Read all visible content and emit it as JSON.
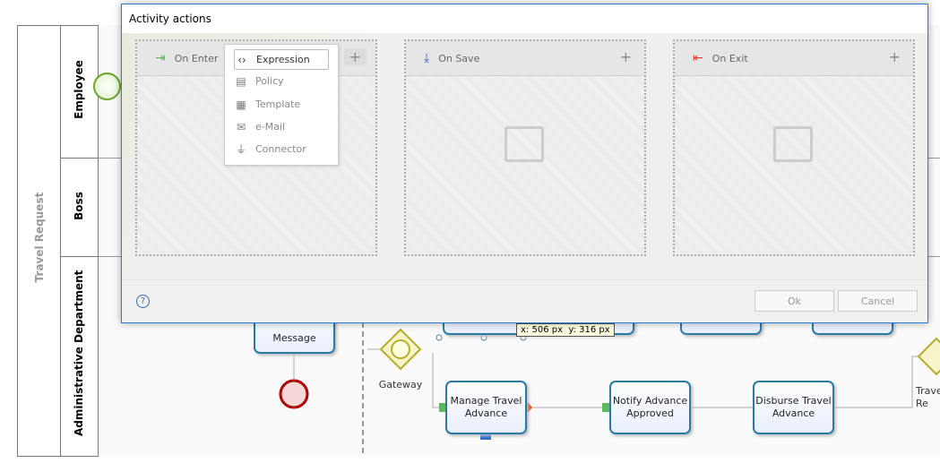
{
  "pool": {
    "label": "Travel Request",
    "lanes": [
      "Employee",
      "Boss",
      "Administrative Department"
    ]
  },
  "diagram": {
    "tasks": {
      "message": "Message",
      "manage": "Manage Travel Advance",
      "notify": "Notify Advance Approved",
      "disburse": "Disburse Travel Advance"
    },
    "gateway_label": "Gateway",
    "partial_label": "Trave… Re",
    "tooltip": "x: 506 px  y: 316 px"
  },
  "dialog": {
    "title": "Activity actions",
    "panels": [
      {
        "label": "On Enter",
        "icon": "enter-icon",
        "color": "#5cb85c"
      },
      {
        "label": "On Save",
        "icon": "download-icon",
        "color": "#3a5fc8"
      },
      {
        "label": "On Exit",
        "icon": "exit-icon",
        "color": "#e03c31"
      }
    ],
    "menu": [
      {
        "label": "Expression",
        "icon": "expression-icon"
      },
      {
        "label": "Policy",
        "icon": "policy-icon"
      },
      {
        "label": "Template",
        "icon": "template-icon"
      },
      {
        "label": "e-Mail",
        "icon": "mail-icon"
      },
      {
        "label": "Connector",
        "icon": "connector-icon"
      }
    ],
    "ok": "Ok",
    "cancel": "Cancel",
    "help": "?"
  }
}
